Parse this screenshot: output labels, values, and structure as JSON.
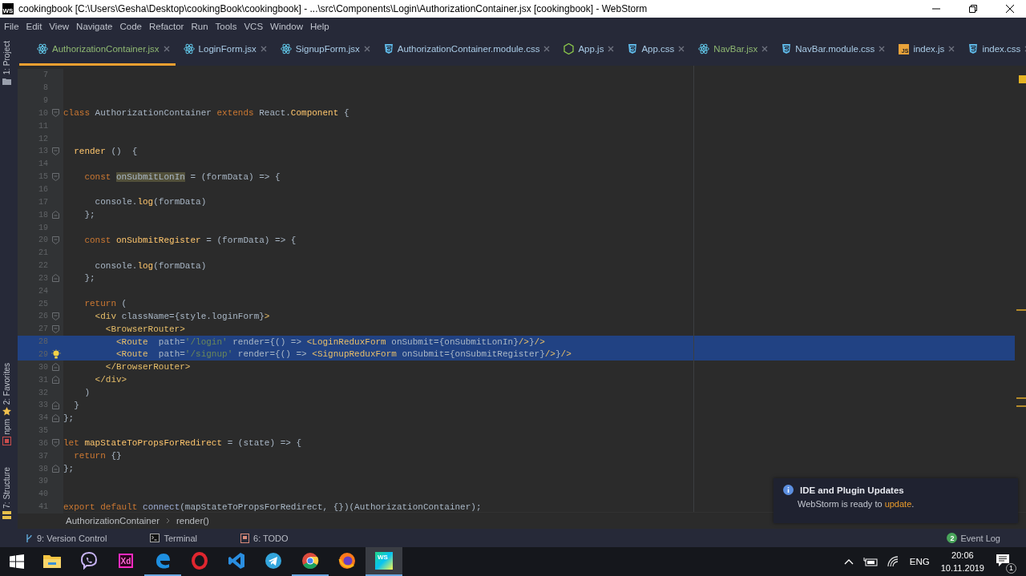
{
  "window": {
    "app_badge": "WS",
    "title": "cookingbook [C:\\Users\\Gesha\\Desktop\\cookingBook\\cookingbook] - ...\\src\\Components\\Login\\AuthorizationContainer.jsx [cookingbook] - WebStorm"
  },
  "menu": [
    "File",
    "Edit",
    "View",
    "Navigate",
    "Code",
    "Refactor",
    "Run",
    "Tools",
    "VCS",
    "Window",
    "Help"
  ],
  "tool_strip": [
    "1: Project",
    "2: Favorites",
    "npm",
    "7: Structure"
  ],
  "tabs": [
    {
      "label": "AuthorizationContainer.jsx",
      "kind": "jsx",
      "selected": true,
      "modified": true
    },
    {
      "label": "LoginForm.jsx",
      "kind": "jsx",
      "selected": false,
      "modified": false
    },
    {
      "label": "SignupForm.jsx",
      "kind": "jsx",
      "selected": false,
      "modified": false
    },
    {
      "label": "AuthorizationContainer.module.css",
      "kind": "css",
      "selected": false,
      "modified": false
    },
    {
      "label": "App.js",
      "kind": "node",
      "selected": false,
      "modified": false
    },
    {
      "label": "App.css",
      "kind": "css",
      "selected": false,
      "modified": false
    },
    {
      "label": "NavBar.jsx",
      "kind": "jsx",
      "selected": false,
      "modified": true
    },
    {
      "label": "NavBar.module.css",
      "kind": "css",
      "selected": false,
      "modified": false
    },
    {
      "label": "index.js",
      "kind": "js",
      "icon_label": "JS",
      "selected": false,
      "modified": false
    },
    {
      "label": "index.css",
      "kind": "css",
      "selected": false,
      "modified": false
    }
  ],
  "code": [
    {
      "number": "7",
      "selected": false,
      "fold_start": false,
      "fold_end": false,
      "lightbulb": false
    },
    {
      "number": "8",
      "selected": false,
      "fold_start": false,
      "fold_end": false,
      "lightbulb": false
    },
    {
      "number": "9",
      "selected": false,
      "fold_start": false,
      "fold_end": false,
      "lightbulb": false
    },
    {
      "number": "10",
      "selected": false,
      "fold_start": true,
      "fold_end": false,
      "lightbulb": false,
      "tokens": [
        {
          "kind": "k",
          "text": "class "
        },
        {
          "kind": "p",
          "text": "AuthorizationContainer "
        },
        {
          "kind": "k",
          "text": "extends "
        },
        {
          "kind": "p",
          "text": "React."
        },
        {
          "kind": "f",
          "text": "Component"
        },
        {
          "kind": "p",
          "text": " {"
        }
      ]
    },
    {
      "number": "11",
      "selected": false,
      "fold_start": false,
      "fold_end": false,
      "lightbulb": false
    },
    {
      "number": "12",
      "selected": false,
      "fold_start": false,
      "fold_end": false,
      "lightbulb": false
    },
    {
      "number": "13",
      "selected": false,
      "fold_start": true,
      "fold_end": false,
      "lightbulb": false,
      "tokens": [
        {
          "kind": "f",
          "text": "  render"
        },
        {
          "kind": "p",
          "text": " ()  {"
        }
      ]
    },
    {
      "number": "14",
      "selected": false,
      "fold_start": false,
      "fold_end": false,
      "lightbulb": false
    },
    {
      "number": "15",
      "selected": false,
      "fold_start": true,
      "fold_end": false,
      "lightbulb": false,
      "tokens": [
        {
          "kind": "k",
          "text": "    const "
        },
        {
          "kind": "u",
          "text": "onSubmitLonIn"
        },
        {
          "kind": "p",
          "text": " = (formData) => {"
        }
      ]
    },
    {
      "number": "16",
      "selected": false,
      "fold_start": false,
      "fold_end": false,
      "lightbulb": false
    },
    {
      "number": "17",
      "selected": false,
      "fold_start": false,
      "fold_end": false,
      "lightbulb": false,
      "tokens": [
        {
          "kind": "p",
          "text": "      console."
        },
        {
          "kind": "f",
          "text": "log"
        },
        {
          "kind": "p",
          "text": "(formData)"
        }
      ]
    },
    {
      "number": "18",
      "selected": false,
      "fold_start": false,
      "fold_end": true,
      "lightbulb": false,
      "tokens": [
        {
          "kind": "p",
          "text": "    };"
        }
      ]
    },
    {
      "number": "19",
      "selected": false,
      "fold_start": false,
      "fold_end": false,
      "lightbulb": false
    },
    {
      "number": "20",
      "selected": false,
      "fold_start": true,
      "fold_end": false,
      "lightbulb": false,
      "tokens": [
        {
          "kind": "k",
          "text": "    const "
        },
        {
          "kind": "f",
          "text": "onSubmitRegister"
        },
        {
          "kind": "p",
          "text": " = (formData) => {"
        }
      ]
    },
    {
      "number": "21",
      "selected": false,
      "fold_start": false,
      "fold_end": false,
      "lightbulb": false
    },
    {
      "number": "22",
      "selected": false,
      "fold_start": false,
      "fold_end": false,
      "lightbulb": false,
      "tokens": [
        {
          "kind": "p",
          "text": "      console."
        },
        {
          "kind": "f",
          "text": "log"
        },
        {
          "kind": "p",
          "text": "(formData)"
        }
      ]
    },
    {
      "number": "23",
      "selected": false,
      "fold_start": false,
      "fold_end": true,
      "lightbulb": false,
      "tokens": [
        {
          "kind": "p",
          "text": "    };"
        }
      ]
    },
    {
      "number": "24",
      "selected": false,
      "fold_start": false,
      "fold_end": false,
      "lightbulb": false
    },
    {
      "number": "25",
      "selected": false,
      "fold_start": false,
      "fold_end": false,
      "lightbulb": false,
      "tokens": [
        {
          "kind": "k",
          "text": "    return"
        },
        {
          "kind": "p",
          "text": " ("
        }
      ]
    },
    {
      "number": "26",
      "selected": false,
      "fold_start": true,
      "fold_end": false,
      "lightbulb": false,
      "tokens": [
        {
          "kind": "t",
          "text": "      <div "
        },
        {
          "kind": "p",
          "text": "className={style.loginForm}"
        },
        {
          "kind": "t",
          "text": ">"
        }
      ]
    },
    {
      "number": "27",
      "selected": false,
      "fold_start": true,
      "fold_end": false,
      "lightbulb": false,
      "tokens": [
        {
          "kind": "t",
          "text": "        <BrowserRouter>"
        }
      ]
    },
    {
      "number": "28",
      "selected": true,
      "fold_start": false,
      "fold_end": false,
      "lightbulb": false,
      "tokens": [
        {
          "kind": "t",
          "text": "          <Route  "
        },
        {
          "kind": "p",
          "text": "path="
        },
        {
          "kind": "s",
          "text": "'/login'"
        },
        {
          "kind": "p",
          "text": " render={() => "
        },
        {
          "kind": "t",
          "text": "<LoginReduxForm "
        },
        {
          "kind": "p",
          "text": "onSubmit={onSubmitLonIn}"
        },
        {
          "kind": "t",
          "text": "/>"
        },
        {
          "kind": "p",
          "text": "}"
        },
        {
          "kind": "t",
          "text": "/>"
        }
      ]
    },
    {
      "number": "29",
      "selected": true,
      "fold_start": false,
      "fold_end": false,
      "lightbulb": true,
      "tokens": [
        {
          "kind": "t",
          "text": "          <Route  "
        },
        {
          "kind": "p",
          "text": "path="
        },
        {
          "kind": "s",
          "text": "'/signup'"
        },
        {
          "kind": "p",
          "text": " render={() => "
        },
        {
          "kind": "t",
          "text": "<SignupReduxForm "
        },
        {
          "kind": "p",
          "text": "onSubmit={onSubmitRegister}"
        },
        {
          "kind": "t",
          "text": "/>"
        },
        {
          "kind": "p",
          "text": "}"
        },
        {
          "kind": "t",
          "text": "/>"
        }
      ]
    },
    {
      "number": "30",
      "selected": false,
      "fold_start": false,
      "fold_end": true,
      "lightbulb": false,
      "tokens": [
        {
          "kind": "t",
          "text": "        </BrowserRouter>"
        }
      ]
    },
    {
      "number": "31",
      "selected": false,
      "fold_start": false,
      "fold_end": true,
      "lightbulb": false,
      "tokens": [
        {
          "kind": "t",
          "text": "      </div>"
        }
      ]
    },
    {
      "number": "32",
      "selected": false,
      "fold_start": false,
      "fold_end": false,
      "lightbulb": false,
      "tokens": [
        {
          "kind": "p",
          "text": "    )"
        }
      ]
    },
    {
      "number": "33",
      "selected": false,
      "fold_start": false,
      "fold_end": true,
      "lightbulb": false,
      "tokens": [
        {
          "kind": "p",
          "text": "  }"
        }
      ]
    },
    {
      "number": "34",
      "selected": false,
      "fold_start": false,
      "fold_end": true,
      "lightbulb": false,
      "tokens": [
        {
          "kind": "p",
          "text": "};"
        }
      ]
    },
    {
      "number": "35",
      "selected": false,
      "fold_start": false,
      "fold_end": false,
      "lightbulb": false
    },
    {
      "number": "36",
      "selected": false,
      "fold_start": true,
      "fold_end": false,
      "lightbulb": false,
      "tokens": [
        {
          "kind": "k",
          "text": "let "
        },
        {
          "kind": "f",
          "text": "mapStateToPropsForRedirect"
        },
        {
          "kind": "p",
          "text": " = (state) => {"
        }
      ]
    },
    {
      "number": "37",
      "selected": false,
      "fold_start": false,
      "fold_end": false,
      "lightbulb": false,
      "tokens": [
        {
          "kind": "k",
          "text": "  return"
        },
        {
          "kind": "p",
          "text": " {}"
        }
      ]
    },
    {
      "number": "38",
      "selected": false,
      "fold_start": false,
      "fold_end": true,
      "lightbulb": false,
      "tokens": [
        {
          "kind": "p",
          "text": "};"
        }
      ]
    },
    {
      "number": "39",
      "selected": false,
      "fold_start": false,
      "fold_end": false,
      "lightbulb": false
    },
    {
      "number": "40",
      "selected": false,
      "fold_start": false,
      "fold_end": false,
      "lightbulb": false
    },
    {
      "number": "41",
      "selected": false,
      "fold_start": false,
      "fold_end": false,
      "lightbulb": false,
      "tokens": [
        {
          "kind": "k",
          "text": "export default "
        },
        {
          "kind": "c",
          "text": "connect"
        },
        {
          "kind": "p",
          "text": "(mapStateToPropsForRedirect, {})(AuthorizationContainer);"
        }
      ]
    }
  ],
  "breadcrumb": [
    "AuthorizationContainer",
    "render()"
  ],
  "bottom_tools": [
    "9: Version Control",
    "Terminal",
    "6: TODO"
  ],
  "event_log": {
    "count": "2",
    "label": "Event Log"
  },
  "notification": {
    "title": "IDE and Plugin Updates",
    "text": "WebStorm is ready to ",
    "link": "update",
    "end": "."
  },
  "taskbar": {
    "apps": [
      {
        "kind": "folder",
        "selected": false,
        "running": false
      },
      {
        "kind": "viber",
        "selected": false,
        "running": false
      },
      {
        "kind": "xd",
        "label": "Xd",
        "selected": false,
        "running": false
      },
      {
        "kind": "edge",
        "selected": false,
        "running": true
      },
      {
        "kind": "opera",
        "selected": false,
        "running": false
      },
      {
        "kind": "vscode",
        "selected": false,
        "running": false
      },
      {
        "kind": "telegram",
        "selected": false,
        "running": false
      },
      {
        "kind": "chrome",
        "selected": false,
        "running": true
      },
      {
        "kind": "firefox",
        "selected": false,
        "running": false
      },
      {
        "kind": "ws",
        "label": "WS",
        "selected": true,
        "running": true
      }
    ],
    "language": "ENG",
    "time": "20:06",
    "date": "10.11.2019",
    "notifications": "1"
  }
}
